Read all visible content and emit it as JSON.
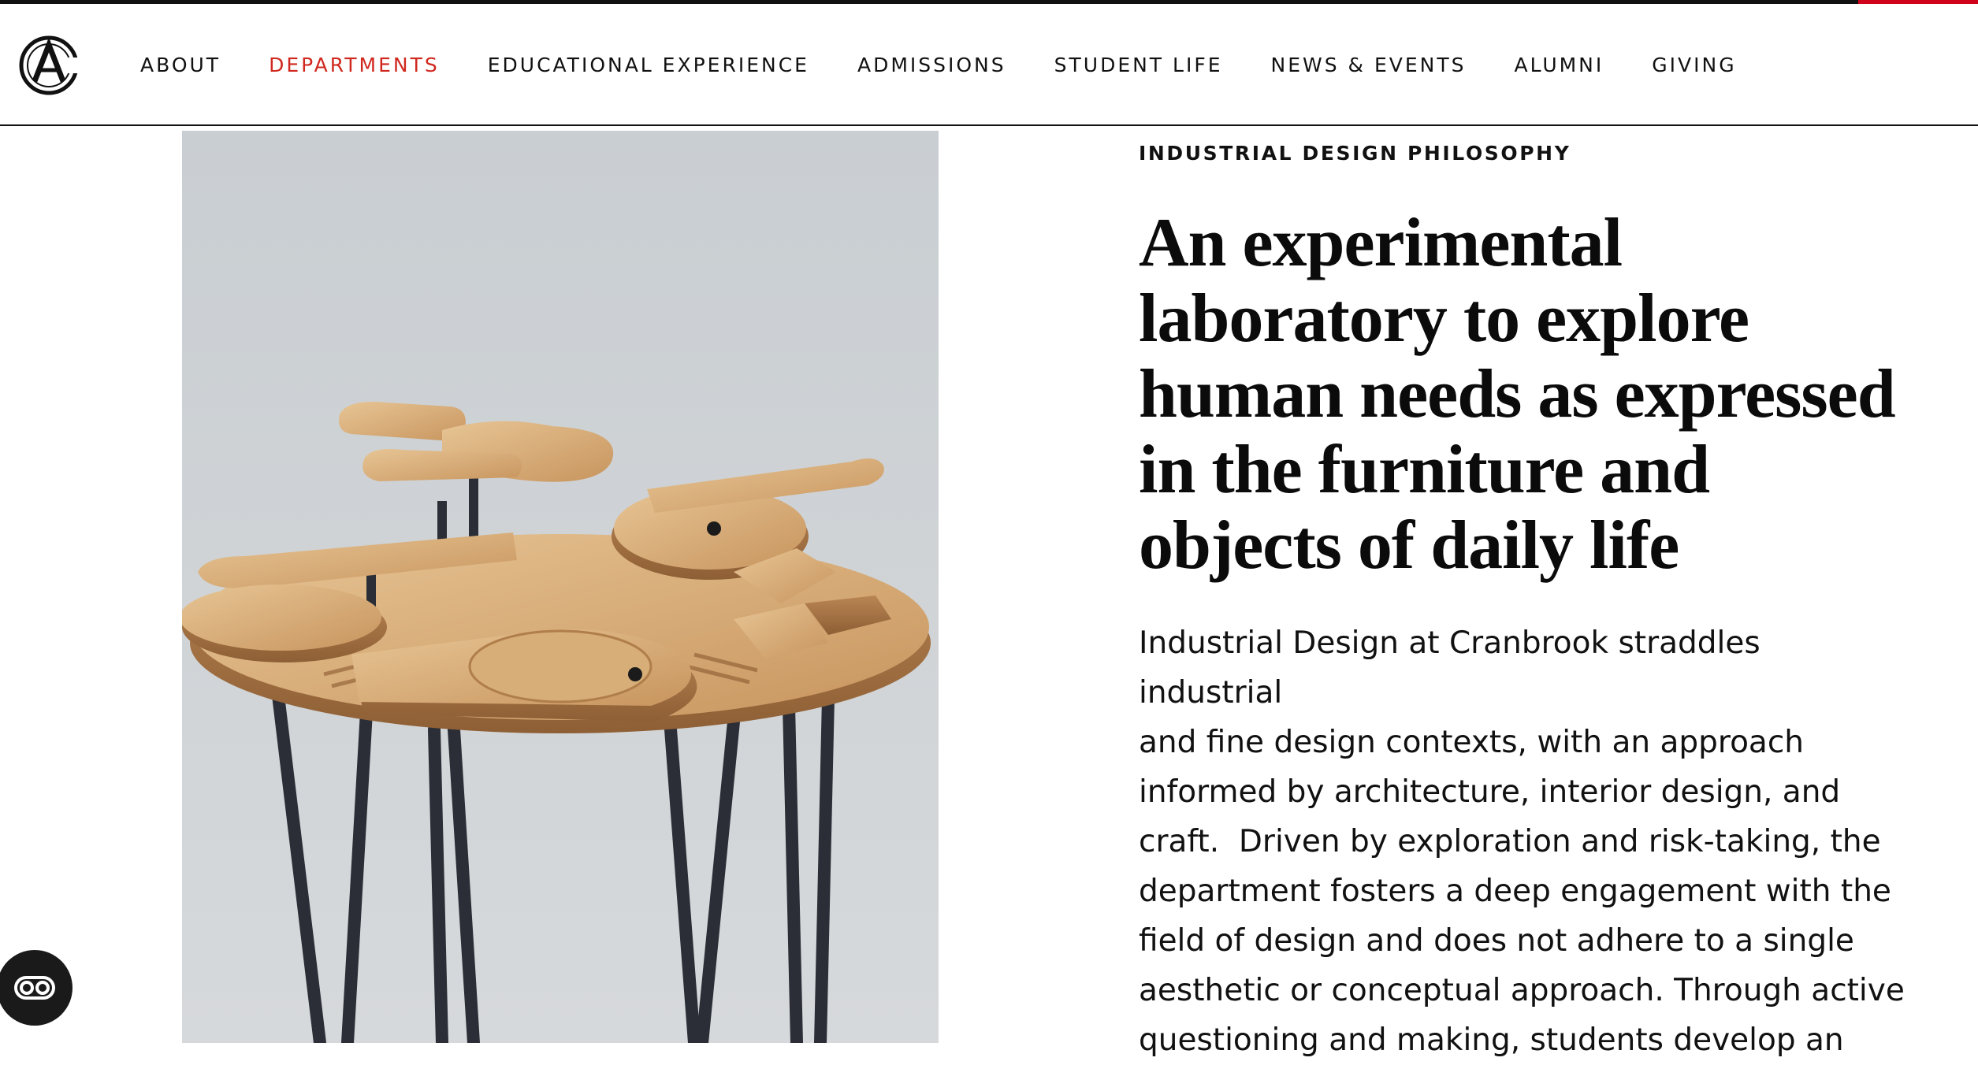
{
  "brand": {
    "logo_icon": "cranbrook-ca-monogram-icon"
  },
  "colors": {
    "accent_red": "#d0281f",
    "text": "#111111",
    "background": "#ffffff"
  },
  "nav": {
    "items": [
      {
        "label": "ABOUT",
        "active": false
      },
      {
        "label": "DEPARTMENTS",
        "active": true
      },
      {
        "label": "EDUCATIONAL EXPERIENCE",
        "active": false
      },
      {
        "label": "ADMISSIONS",
        "active": false
      },
      {
        "label": "STUDENT LIFE",
        "active": false
      },
      {
        "label": "NEWS & EVENTS",
        "active": false
      },
      {
        "label": "ALUMNI",
        "active": false
      },
      {
        "label": "GIVING",
        "active": false
      }
    ]
  },
  "main": {
    "eyebrow": "INDUSTRIAL DESIGN PHILOSOPHY",
    "headline_lines": [
      "An experimental",
      "laboratory to explore",
      "human needs as expressed",
      "in the furniture and",
      "objects of daily life"
    ],
    "intro_lines": [
      "Industrial Design at Cranbrook straddles industrial",
      "and fine design contexts, with an approach",
      "informed by architecture, interior design, and",
      "craft.  Driven by exploration and risk-taking, the",
      "department fosters a deep engagement with the",
      "field of design and does not adhere to a single",
      "aesthetic or conceptual approach. Through active",
      "questioning and making, students develop an"
    ]
  },
  "image": {
    "subject": "wooden-table-photo"
  },
  "accessibility_button": {
    "icon": "accessibility-toggle-icon"
  }
}
